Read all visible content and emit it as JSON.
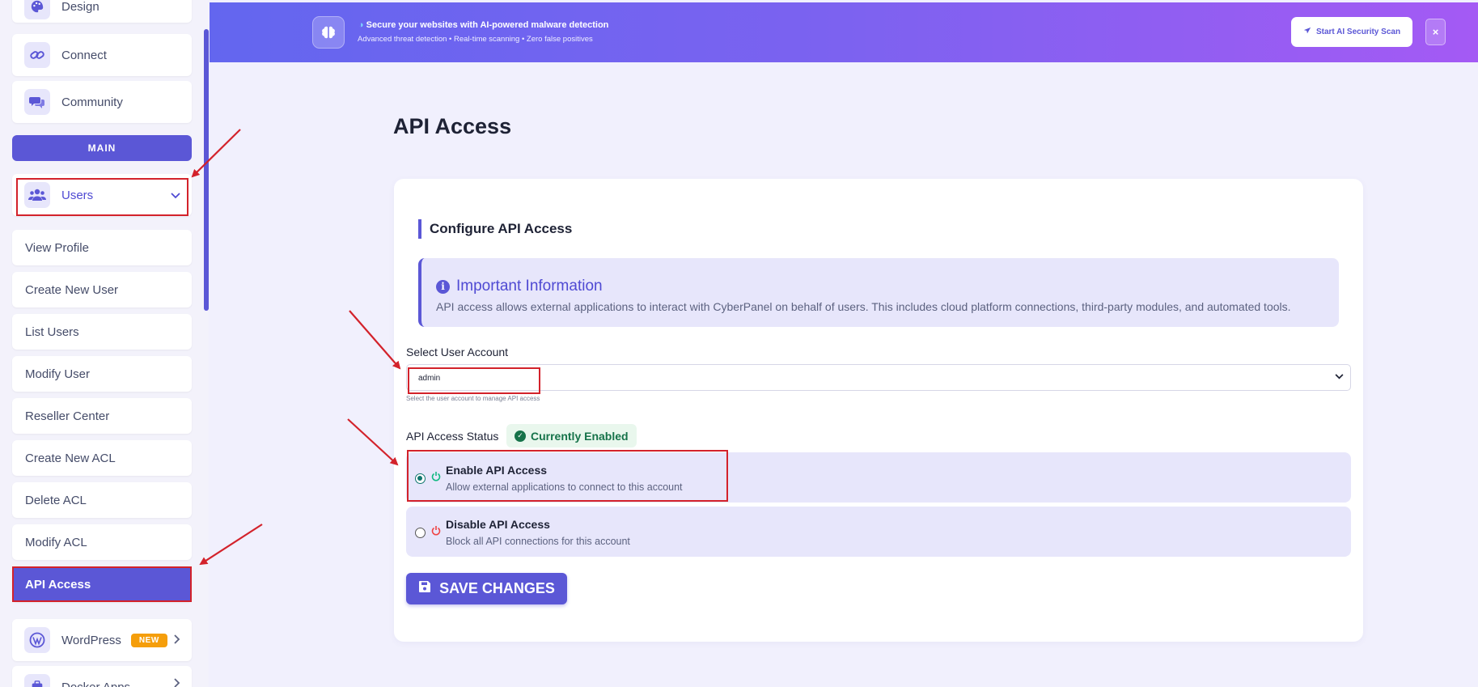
{
  "sidebar": {
    "top_items": [
      {
        "label": "Design",
        "icon": "palette-icon"
      },
      {
        "label": "Connect",
        "icon": "link-icon"
      },
      {
        "label": "Community",
        "icon": "comments-icon"
      }
    ],
    "section_label": "MAIN",
    "users": {
      "label": "Users",
      "icon": "users-icon"
    },
    "sub_items": [
      "View Profile",
      "Create New User",
      "List Users",
      "Modify User",
      "Reseller Center",
      "Create New ACL",
      "Delete ACL",
      "Modify ACL",
      "API Access"
    ],
    "active_item": "API Access",
    "wordpress": {
      "label": "WordPress",
      "badge": "NEW",
      "icon": "wordpress-icon"
    },
    "docker": {
      "label": "Docker Apps",
      "icon": "docker-icon"
    }
  },
  "banner": {
    "title": "Secure your websites with AI-powered malware detection",
    "subtitle": "Advanced threat detection • Real-time scanning • Zero false positives",
    "button": "Start AI Security Scan",
    "close": "×",
    "icon": "brain-icon"
  },
  "page": {
    "title": "API Access",
    "card_title": "Configure API Access",
    "info": {
      "title": "Important Information",
      "text": "API access allows external applications to interact with CyberPanel on behalf of users. This includes cloud platform connections, third-party modules, and automated tools."
    },
    "select": {
      "label": "Select User Account",
      "value": "admin",
      "hint": "Select the user account to manage API access"
    },
    "status": {
      "label": "API Access Status",
      "badge": "Currently Enabled"
    },
    "options": [
      {
        "title": "Enable API Access",
        "desc": "Allow external applications to connect to this account",
        "checked": true
      },
      {
        "title": "Disable API Access",
        "desc": "Block all API connections for this account",
        "checked": false
      }
    ],
    "save_button": "SAVE CHANGES"
  },
  "colors": {
    "accent": "#5b57d6",
    "annotation": "#d3222b",
    "success": "#16734a"
  }
}
